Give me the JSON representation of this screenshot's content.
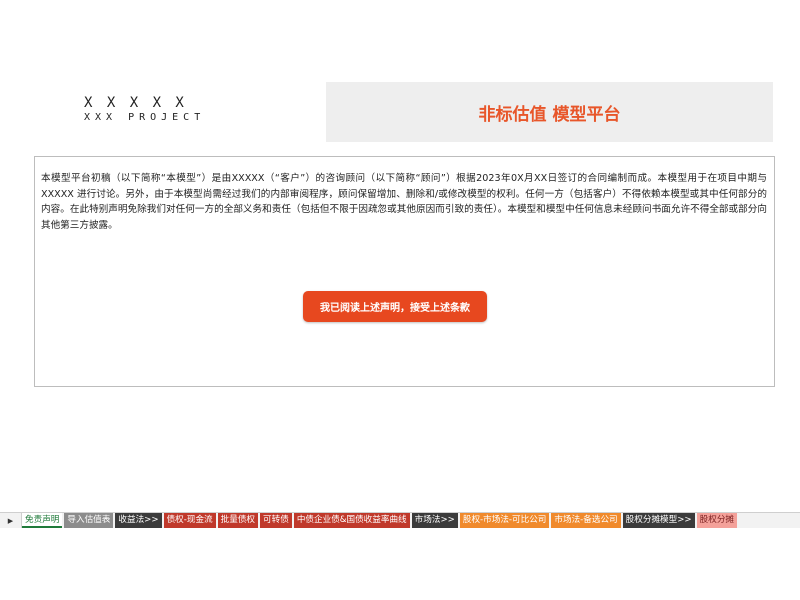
{
  "logo": {
    "mark": "X X X X X",
    "name": "XXX PROJECT"
  },
  "header": {
    "title": "非标估值 模型平台"
  },
  "notice": {
    "text": "本模型平台初稿（以下简称“本模型”）是由XXXXX（“客户”）的咨询顾问（以下简称“顾问”）根据2023年0X月XX日签订的合同编制而成。本模型用于在项目中期与XXXXX 进行讨论。另外，由于本模型尚需经过我们的内部审阅程序，顾问保留增加、删除和/或修改模型的权利。任何一方（包括客户）不得依赖本模型或其中任何部分的内容。在此特别声明免除我们对任何一方的全部义务和责任（包括但不限于因疏忽或其他原因而引致的责任）。本模型和模型中任何信息未经顾问书面允许不得全部或部分向其他第三方披露。",
    "accept_label": "我已阅读上述声明，接受上述条款"
  },
  "sheet_tabs": {
    "nav_icon": "right-triangle",
    "items": [
      {
        "label": "免责声明",
        "bg": "#ffffff",
        "fg": "#1f7a3a",
        "active": true
      },
      {
        "label": "导入估值表",
        "bg": "#8c8c8c",
        "fg": "#ffffff"
      },
      {
        "label": "收益法>>",
        "bg": "#3b3b3b",
        "fg": "#ffffff"
      },
      {
        "label": "债权-现金流",
        "bg": "#c0392b",
        "fg": "#ffffff"
      },
      {
        "label": "批量债权",
        "bg": "#c0392b",
        "fg": "#ffffff"
      },
      {
        "label": "可转债",
        "bg": "#c0392b",
        "fg": "#ffffff"
      },
      {
        "label": "中债企业债&国债收益率曲线",
        "bg": "#c0392b",
        "fg": "#ffffff"
      },
      {
        "label": "市场法>>",
        "bg": "#3b3b3b",
        "fg": "#ffffff"
      },
      {
        "label": "股权-市场法-可比公司",
        "bg": "#f08a2c",
        "fg": "#ffffff"
      },
      {
        "label": "市场法-备选公司",
        "bg": "#f08a2c",
        "fg": "#ffffff"
      },
      {
        "label": "股权分摊模型>>",
        "bg": "#3b3b3b",
        "fg": "#ffffff"
      },
      {
        "label": "股权分摊",
        "bg": "#f4a19a",
        "fg": "#7a1f1f"
      }
    ]
  }
}
